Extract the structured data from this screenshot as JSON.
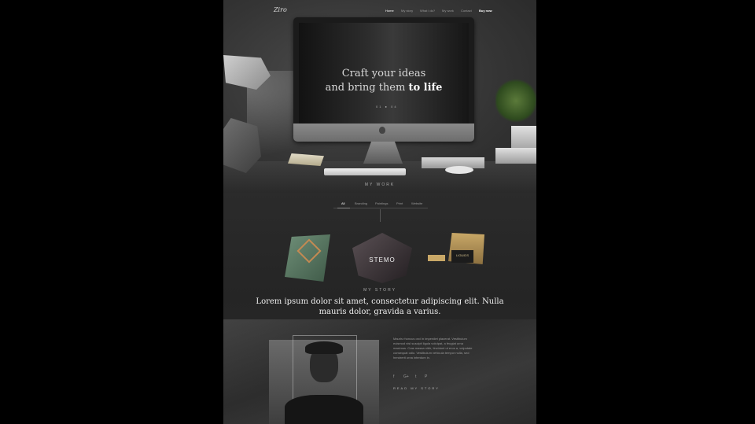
{
  "nav": {
    "logo": "Ziro",
    "items": [
      "Home",
      "My story",
      "What i do?",
      "My work",
      "Contact",
      "Buy now"
    ]
  },
  "hero": {
    "title_line1": "Craft your ideas",
    "title_line2_prefix": "and bring them ",
    "title_line2_emphasis": "to life",
    "slide_indicator": "01 ● 04"
  },
  "work": {
    "section_label": "MY WORK",
    "filters": [
      "All",
      "Branding",
      "Paintings",
      "Print",
      "Website"
    ],
    "items": [
      {
        "label": ""
      },
      {
        "label": "STEMO"
      },
      {
        "label": "LIGUIDS"
      }
    ]
  },
  "story": {
    "section_label": "MY STORY",
    "title": "Lorem ipsum dolor sit amet, consectetur adipiscing elit. Nulla mauris dolor, gravida a varius.",
    "body": "Mauris rhoncus orci in imperdiet placerat. Vestibulum euismod nisl suscipit ligula volutpat, a feugiat urna maximus. Cras massa nibh, tincidunt ut eros a, vulputate consequat odio. Vestibulum vehicula tempor nulla, sed hendrerit urna interdum in.",
    "social": [
      "f",
      "G+",
      "t",
      "P"
    ],
    "read_more": "READ MY STORY"
  },
  "colors": {
    "accent": "#c58a52"
  }
}
